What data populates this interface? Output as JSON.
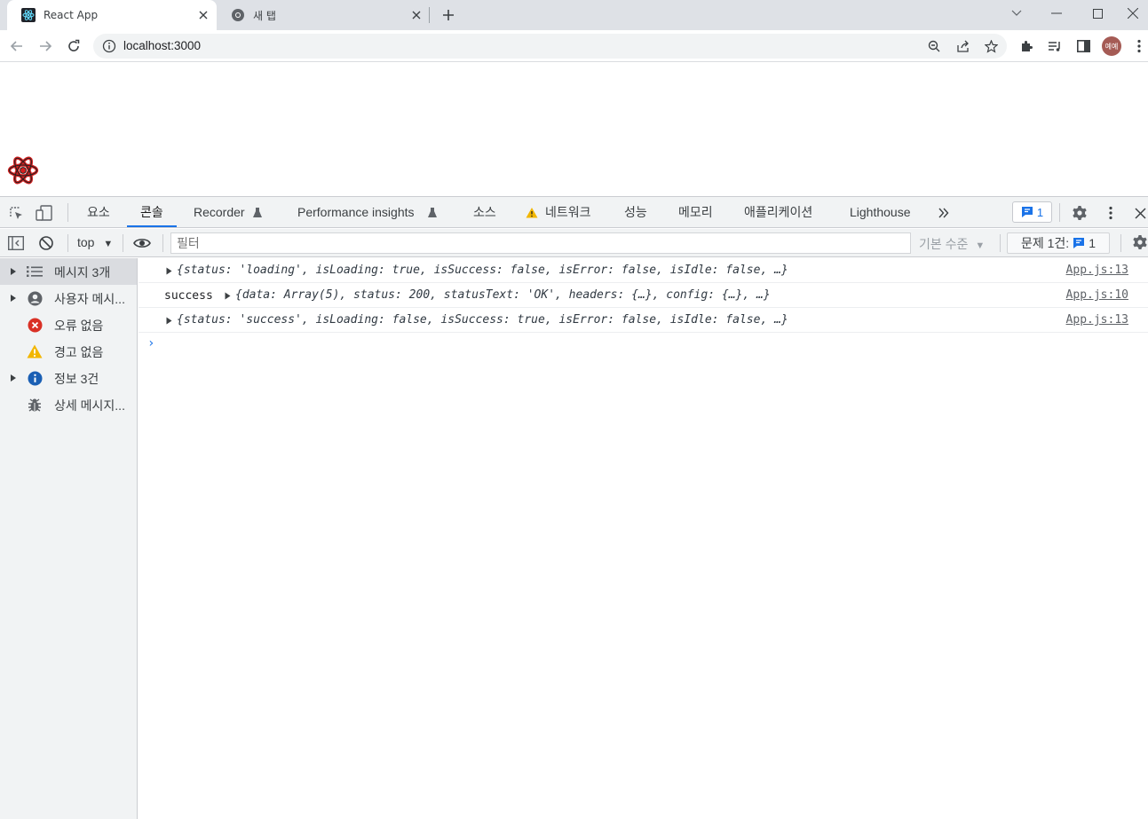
{
  "browser": {
    "tabs": [
      {
        "title": "React App",
        "active": true,
        "favicon": "react-icon"
      },
      {
        "title": "새 탭",
        "active": false,
        "favicon": "chrome-icon"
      }
    ],
    "url": "localhost:3000",
    "avatar_text": "예예"
  },
  "devtools": {
    "panels": [
      "요소",
      "콘솔",
      "Recorder",
      "Performance insights",
      "소스",
      "네트워크",
      "성능",
      "메모리",
      "애플리케이션",
      "Lighthouse"
    ],
    "active_panel": "콘솔",
    "issue_count": "1",
    "context": "top",
    "filter_placeholder": "필터",
    "levels": "기본 수준",
    "issues_label": "문제 1건:",
    "issues_count": "1",
    "sidebar": [
      {
        "label": "메시지 3개",
        "icon": "list-icon",
        "expandable": true,
        "selected": true
      },
      {
        "label": "사용자 메시...",
        "icon": "user-icon",
        "expandable": true
      },
      {
        "label": "오류 없음",
        "icon": "error-icon",
        "expandable": false
      },
      {
        "label": "경고 없음",
        "icon": "warning-icon",
        "expandable": false
      },
      {
        "label": "정보 3건",
        "icon": "info-icon",
        "expandable": true
      },
      {
        "label": "상세 메시지...",
        "icon": "bug-icon",
        "expandable": false
      }
    ],
    "console": {
      "rows": [
        {
          "prefix": "",
          "text": "{status: 'loading', isLoading: true, isSuccess: false, isError: false, isIdle: false, …}",
          "source": "App.js:13"
        },
        {
          "prefix": "success",
          "text": "{data: Array(5), status: 200, statusText: 'OK', headers: {…}, config: {…}, …}",
          "source": "App.js:10"
        },
        {
          "prefix": "",
          "text": "{status: 'success', isLoading: false, isSuccess: true, isError: false, isIdle: false, …}",
          "source": "App.js:13"
        }
      ]
    }
  },
  "colors": {
    "accent": "#1a73e8",
    "error": "#d93025",
    "warning": "#f2b600",
    "info": "#1a73e8"
  }
}
